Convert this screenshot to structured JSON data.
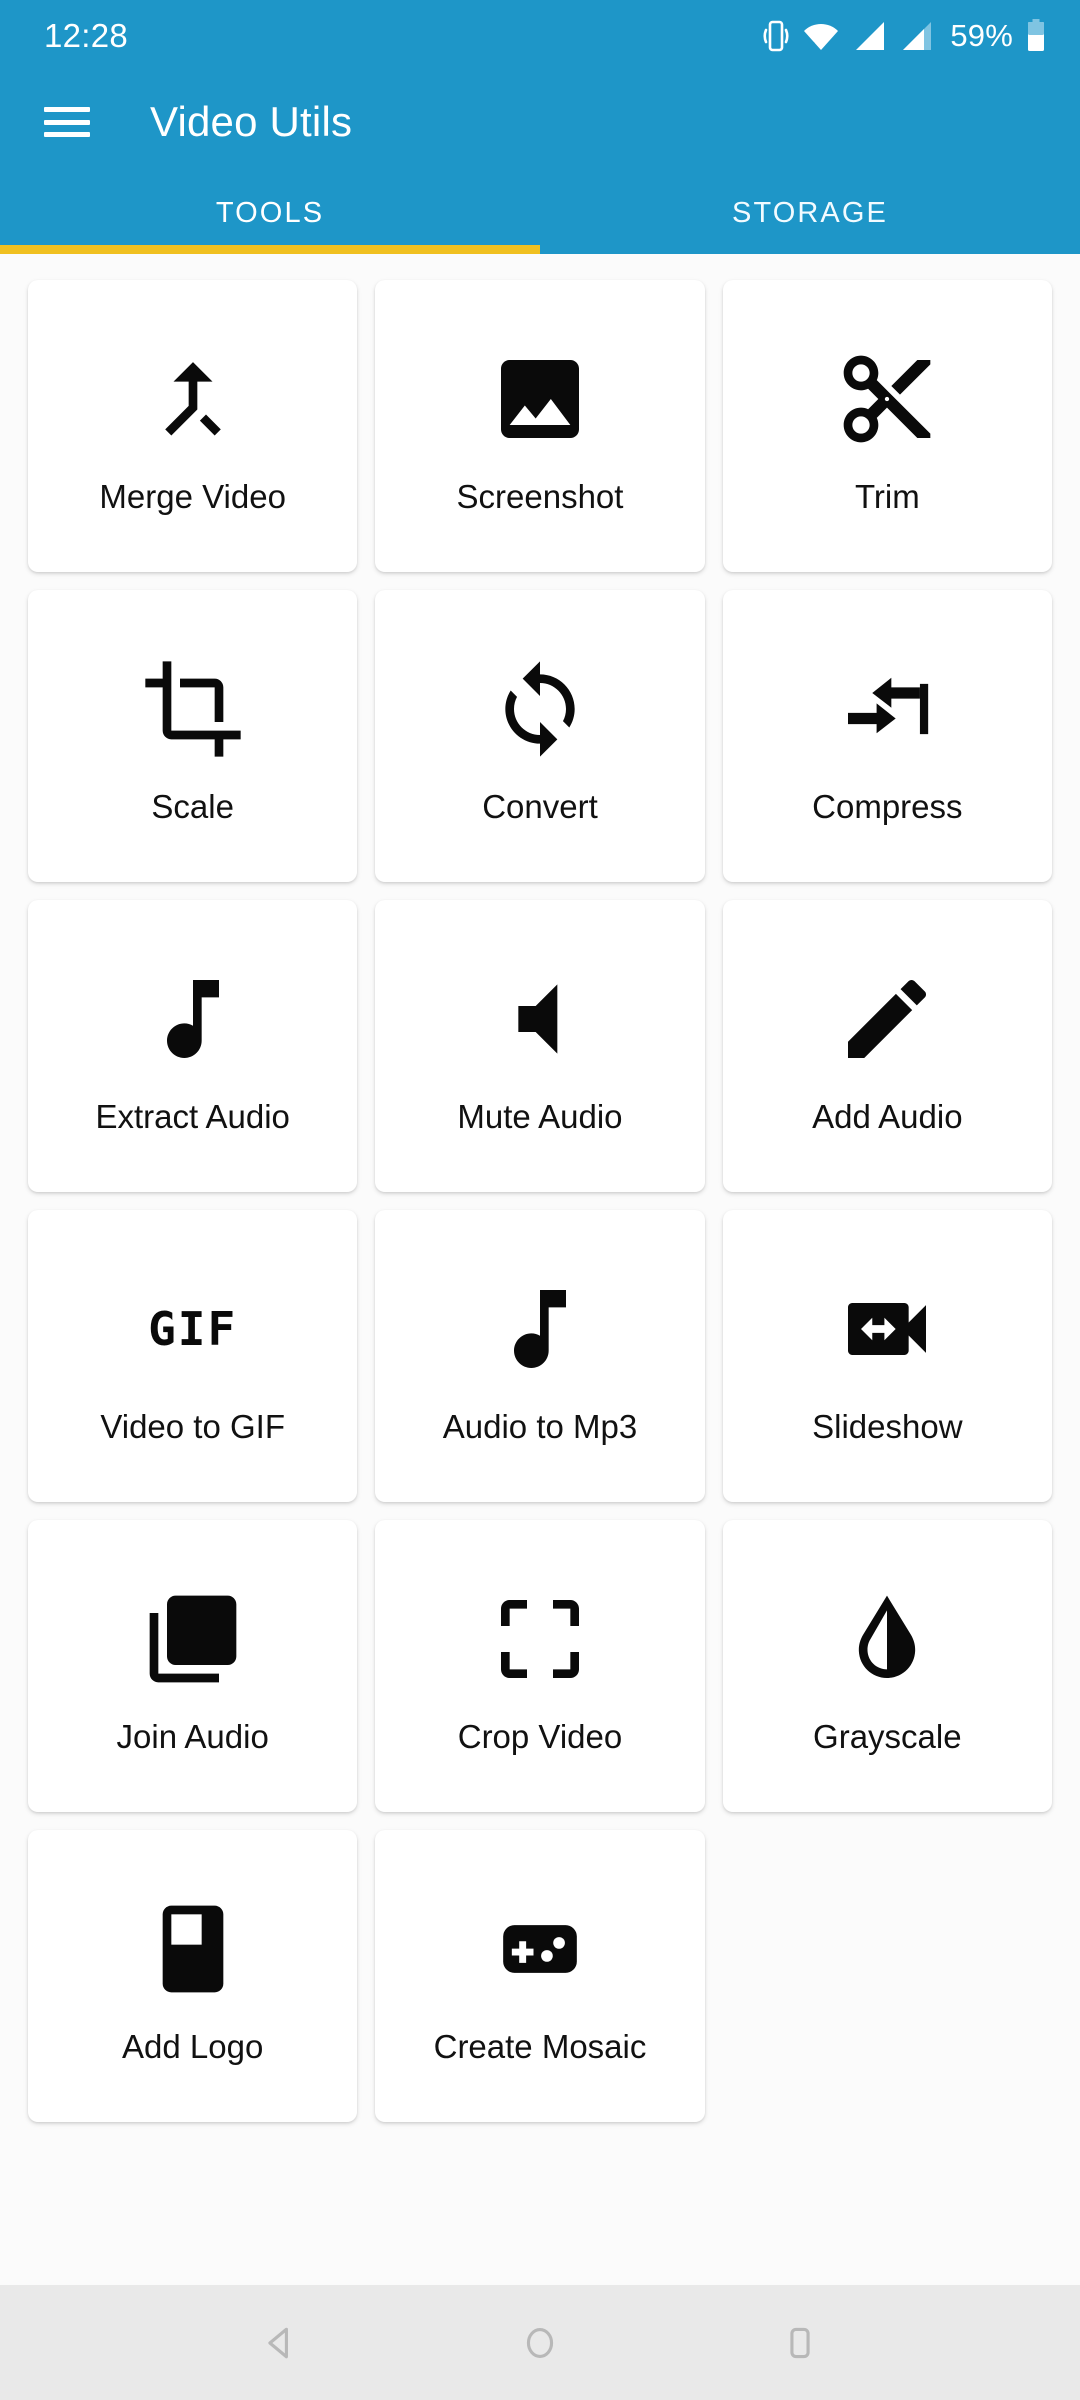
{
  "status_bar": {
    "clock": "12:28",
    "battery_percent": "59%",
    "icons": [
      "vibrate-icon",
      "wifi-icon",
      "signal-sim1-icon",
      "signal-sim2-icon",
      "battery-icon"
    ]
  },
  "app_bar": {
    "menu_icon": "hamburger-menu-icon",
    "title": "Video Utils"
  },
  "tabs": {
    "items": [
      {
        "label": "TOOLS",
        "active": true
      },
      {
        "label": "STORAGE",
        "active": false
      }
    ],
    "indicator_color": "#f0c020"
  },
  "theme": {
    "primary": "#1e96c8",
    "accent": "#f0c020",
    "background": "#fbfbfb",
    "card": "#ffffff",
    "icon": "#0a0a0a",
    "nav_bar": "#e9e9e9"
  },
  "tools": [
    {
      "label": "Merge Video",
      "icon": "call-merge-icon"
    },
    {
      "label": "Screenshot",
      "icon": "image-photo-icon"
    },
    {
      "label": "Trim",
      "icon": "scissors-icon"
    },
    {
      "label": "Scale",
      "icon": "crop-rotate-icon"
    },
    {
      "label": "Convert",
      "icon": "sync-refresh-icon"
    },
    {
      "label": "Compress",
      "icon": "compress-arrows-icon"
    },
    {
      "label": "Extract Audio",
      "icon": "music-note-icon"
    },
    {
      "label": "Mute Audio",
      "icon": "speaker-mute-icon"
    },
    {
      "label": "Add Audio",
      "icon": "pencil-edit-icon"
    },
    {
      "label": "Video to GIF",
      "icon": "gif-text-icon"
    },
    {
      "label": "Audio to Mp3",
      "icon": "music-note-icon"
    },
    {
      "label": "Slideshow",
      "icon": "video-slideshow-icon"
    },
    {
      "label": "Join Audio",
      "icon": "library-music-icon"
    },
    {
      "label": "Crop Video",
      "icon": "crop-free-icon"
    },
    {
      "label": "Grayscale",
      "icon": "droplet-half-icon"
    },
    {
      "label": "Add Logo",
      "icon": "branding-watermark-icon"
    },
    {
      "label": "Create Mosaic",
      "icon": "gamepad-mosaic-icon"
    }
  ],
  "nav_bar": {
    "buttons": [
      {
        "name": "back-button",
        "icon": "triangle-back-icon"
      },
      {
        "name": "home-button",
        "icon": "circle-home-icon"
      },
      {
        "name": "recents-button",
        "icon": "square-recents-icon"
      }
    ]
  }
}
